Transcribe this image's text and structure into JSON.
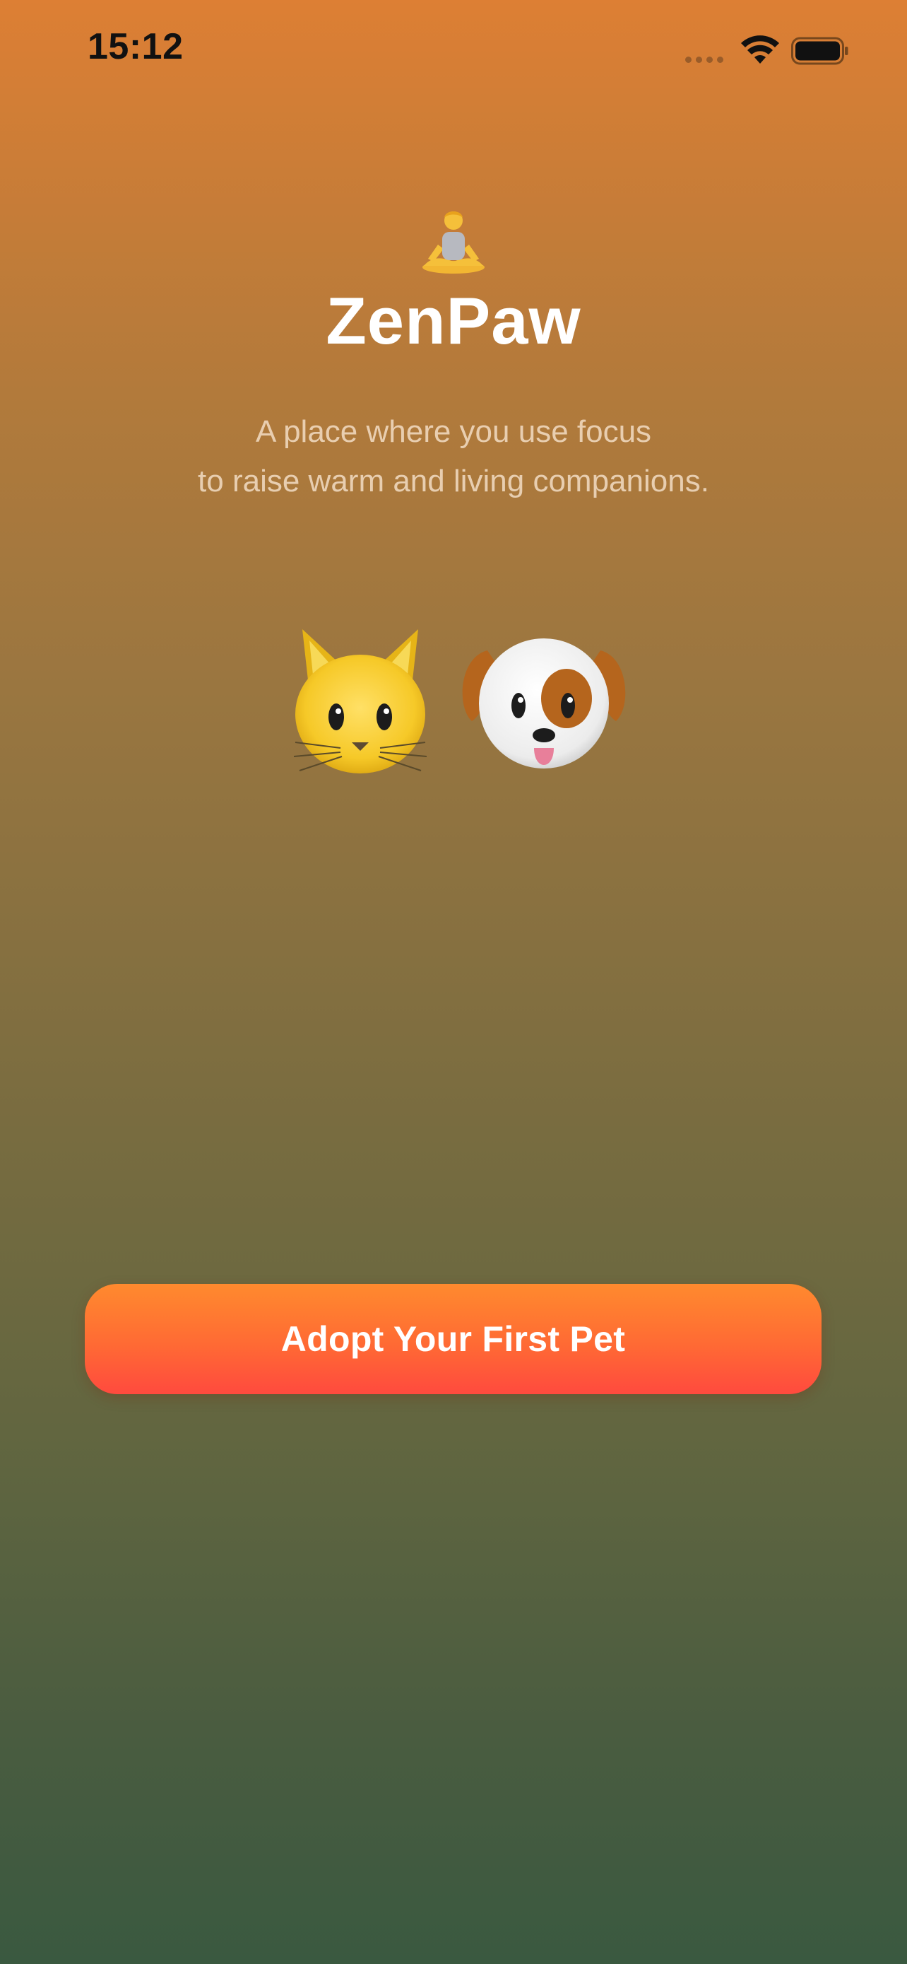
{
  "status_bar": {
    "time": "15:12",
    "icons": [
      "signal-dots-icon",
      "wifi-icon",
      "battery-icon"
    ]
  },
  "header": {
    "icon": "meditation-person-icon",
    "title": "ZenPaw",
    "tagline_line1": "A place where you use focus",
    "tagline_line2": "to raise warm and living companions."
  },
  "pets": [
    {
      "name": "cat",
      "icon": "cat-face-icon"
    },
    {
      "name": "dog",
      "icon": "dog-face-icon"
    }
  ],
  "cta": {
    "label": "Adopt Your First Pet"
  },
  "colors": {
    "background_top": "#dd7f34",
    "background_bottom": "#3a5940",
    "button_top": "#ff8a2e",
    "button_bottom": "#ff4a3e",
    "title": "#ffffff"
  }
}
